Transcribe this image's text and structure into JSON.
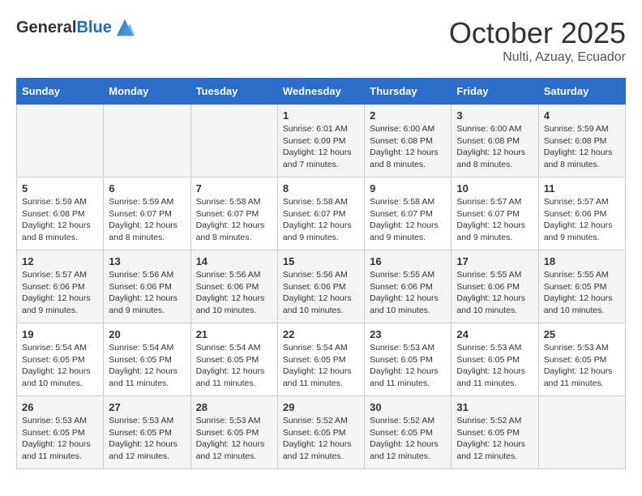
{
  "header": {
    "logo_general": "General",
    "logo_blue": "Blue",
    "month_title": "October 2025",
    "location": "Nulti, Azuay, Ecuador"
  },
  "weekdays": [
    "Sunday",
    "Monday",
    "Tuesday",
    "Wednesday",
    "Thursday",
    "Friday",
    "Saturday"
  ],
  "weeks": [
    [
      {
        "day": "",
        "content": ""
      },
      {
        "day": "",
        "content": ""
      },
      {
        "day": "",
        "content": ""
      },
      {
        "day": "1",
        "content": "Sunrise: 6:01 AM\nSunset: 6:09 PM\nDaylight: 12 hours and 7 minutes."
      },
      {
        "day": "2",
        "content": "Sunrise: 6:00 AM\nSunset: 6:08 PM\nDaylight: 12 hours and 8 minutes."
      },
      {
        "day": "3",
        "content": "Sunrise: 6:00 AM\nSunset: 6:08 PM\nDaylight: 12 hours and 8 minutes."
      },
      {
        "day": "4",
        "content": "Sunrise: 5:59 AM\nSunset: 6:08 PM\nDaylight: 12 hours and 8 minutes."
      }
    ],
    [
      {
        "day": "5",
        "content": "Sunrise: 5:59 AM\nSunset: 6:08 PM\nDaylight: 12 hours and 8 minutes."
      },
      {
        "day": "6",
        "content": "Sunrise: 5:59 AM\nSunset: 6:07 PM\nDaylight: 12 hours and 8 minutes."
      },
      {
        "day": "7",
        "content": "Sunrise: 5:58 AM\nSunset: 6:07 PM\nDaylight: 12 hours and 8 minutes."
      },
      {
        "day": "8",
        "content": "Sunrise: 5:58 AM\nSunset: 6:07 PM\nDaylight: 12 hours and 9 minutes."
      },
      {
        "day": "9",
        "content": "Sunrise: 5:58 AM\nSunset: 6:07 PM\nDaylight: 12 hours and 9 minutes."
      },
      {
        "day": "10",
        "content": "Sunrise: 5:57 AM\nSunset: 6:07 PM\nDaylight: 12 hours and 9 minutes."
      },
      {
        "day": "11",
        "content": "Sunrise: 5:57 AM\nSunset: 6:06 PM\nDaylight: 12 hours and 9 minutes."
      }
    ],
    [
      {
        "day": "12",
        "content": "Sunrise: 5:57 AM\nSunset: 6:06 PM\nDaylight: 12 hours and 9 minutes."
      },
      {
        "day": "13",
        "content": "Sunrise: 5:56 AM\nSunset: 6:06 PM\nDaylight: 12 hours and 9 minutes."
      },
      {
        "day": "14",
        "content": "Sunrise: 5:56 AM\nSunset: 6:06 PM\nDaylight: 12 hours and 10 minutes."
      },
      {
        "day": "15",
        "content": "Sunrise: 5:56 AM\nSunset: 6:06 PM\nDaylight: 12 hours and 10 minutes."
      },
      {
        "day": "16",
        "content": "Sunrise: 5:55 AM\nSunset: 6:06 PM\nDaylight: 12 hours and 10 minutes."
      },
      {
        "day": "17",
        "content": "Sunrise: 5:55 AM\nSunset: 6:06 PM\nDaylight: 12 hours and 10 minutes."
      },
      {
        "day": "18",
        "content": "Sunrise: 5:55 AM\nSunset: 6:05 PM\nDaylight: 12 hours and 10 minutes."
      }
    ],
    [
      {
        "day": "19",
        "content": "Sunrise: 5:54 AM\nSunset: 6:05 PM\nDaylight: 12 hours and 10 minutes."
      },
      {
        "day": "20",
        "content": "Sunrise: 5:54 AM\nSunset: 6:05 PM\nDaylight: 12 hours and 11 minutes."
      },
      {
        "day": "21",
        "content": "Sunrise: 5:54 AM\nSunset: 6:05 PM\nDaylight: 12 hours and 11 minutes."
      },
      {
        "day": "22",
        "content": "Sunrise: 5:54 AM\nSunset: 6:05 PM\nDaylight: 12 hours and 11 minutes."
      },
      {
        "day": "23",
        "content": "Sunrise: 5:53 AM\nSunset: 6:05 PM\nDaylight: 12 hours and 11 minutes."
      },
      {
        "day": "24",
        "content": "Sunrise: 5:53 AM\nSunset: 6:05 PM\nDaylight: 12 hours and 11 minutes."
      },
      {
        "day": "25",
        "content": "Sunrise: 5:53 AM\nSunset: 6:05 PM\nDaylight: 12 hours and 11 minutes."
      }
    ],
    [
      {
        "day": "26",
        "content": "Sunrise: 5:53 AM\nSunset: 6:05 PM\nDaylight: 12 hours and 11 minutes."
      },
      {
        "day": "27",
        "content": "Sunrise: 5:53 AM\nSunset: 6:05 PM\nDaylight: 12 hours and 12 minutes."
      },
      {
        "day": "28",
        "content": "Sunrise: 5:53 AM\nSunset: 6:05 PM\nDaylight: 12 hours and 12 minutes."
      },
      {
        "day": "29",
        "content": "Sunrise: 5:52 AM\nSunset: 6:05 PM\nDaylight: 12 hours and 12 minutes."
      },
      {
        "day": "30",
        "content": "Sunrise: 5:52 AM\nSunset: 6:05 PM\nDaylight: 12 hours and 12 minutes."
      },
      {
        "day": "31",
        "content": "Sunrise: 5:52 AM\nSunset: 6:05 PM\nDaylight: 12 hours and 12 minutes."
      },
      {
        "day": "",
        "content": ""
      }
    ]
  ]
}
